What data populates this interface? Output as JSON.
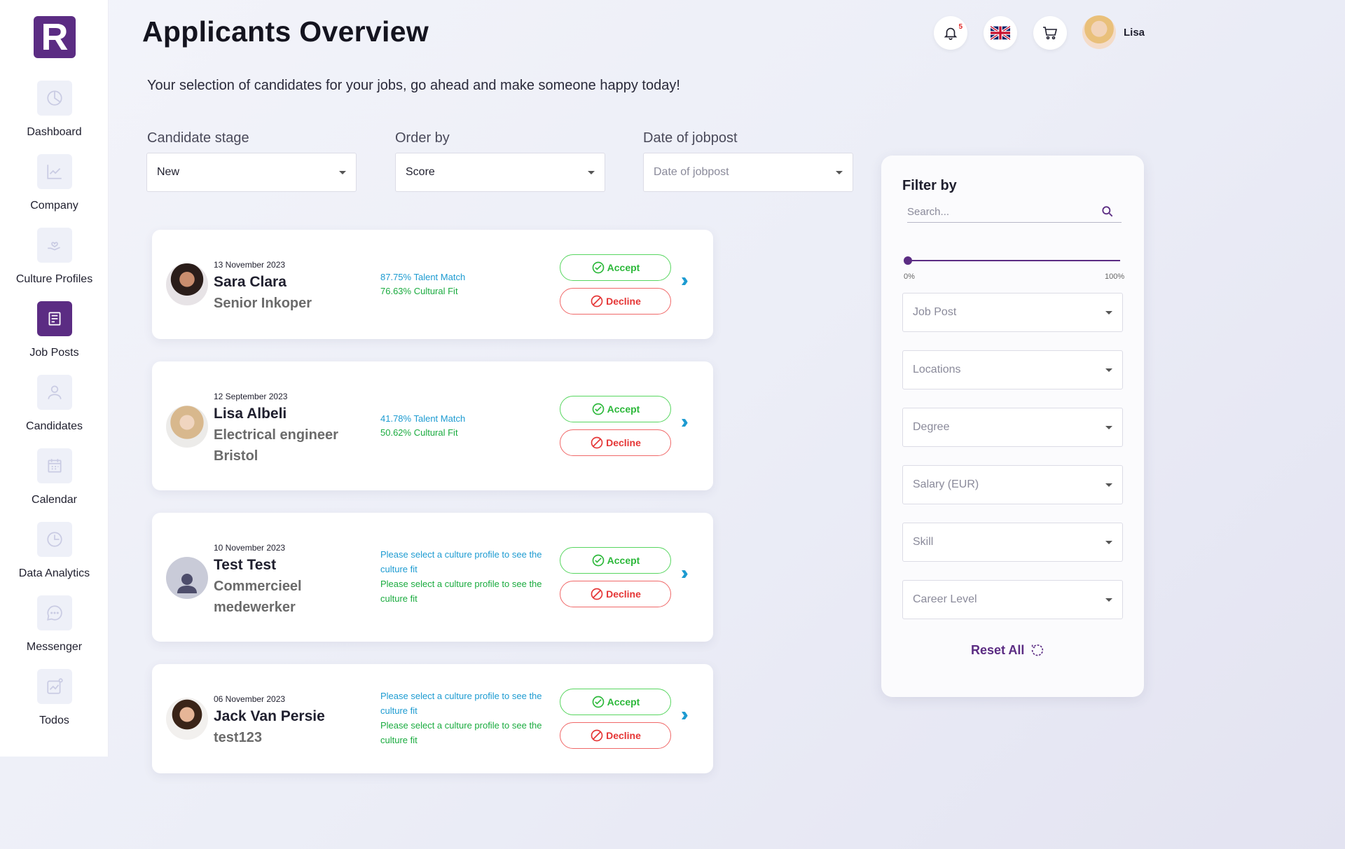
{
  "sidebar": {
    "logo": "R",
    "items": [
      {
        "label": "Dashboard",
        "icon": "pie-chart-icon"
      },
      {
        "label": "Company",
        "icon": "trend-chart-icon"
      },
      {
        "label": "Culture Profiles",
        "icon": "hand-heart-icon"
      },
      {
        "label": "Job Posts",
        "icon": "document-icon",
        "active": true
      },
      {
        "label": "Candidates",
        "icon": "user-icon"
      },
      {
        "label": "Calendar",
        "icon": "calendar-icon"
      },
      {
        "label": "Data Analytics",
        "icon": "clock-chart-icon"
      },
      {
        "label": "Messenger",
        "icon": "chat-icon"
      },
      {
        "label": "Todos",
        "icon": "todo-chart-icon"
      }
    ]
  },
  "header": {
    "title": "Applicants Overview",
    "subtitle": "Your selection of candidates for your jobs, go ahead and make someone happy today!",
    "notification_count": "5",
    "user_name": "Lisa"
  },
  "filters": {
    "stage": {
      "label": "Candidate stage",
      "value": "New"
    },
    "order": {
      "label": "Order by",
      "value": "Score"
    },
    "date": {
      "label": "Date of jobpost",
      "placeholder": "Date of jobpost"
    }
  },
  "candidates": [
    {
      "date": "13 November 2023",
      "name": "Sara Clara",
      "role_lines": [
        "Senior Inkoper"
      ],
      "talent": "87.75% Talent Match",
      "culture": "76.63% Cultural Fit"
    },
    {
      "date": "12 September 2023",
      "name": "Lisa Albeli",
      "role_lines": [
        "Electrical engineer",
        "Bristol"
      ],
      "talent": "41.78% Talent Match",
      "culture": "50.62% Cultural Fit"
    },
    {
      "date": "10 November 2023",
      "name": "Test Test",
      "role_lines": [
        "Commercieel",
        "medewerker"
      ],
      "talent": "Please select a culture profile to see the culture fit",
      "culture": "Please select a culture profile to see the culture fit"
    },
    {
      "date": "06 November 2023",
      "name": "Jack Van Persie",
      "role_lines": [
        "test123"
      ],
      "talent": "Please select a culture profile to see the culture fit",
      "culture": "Please select a culture profile to see the culture fit"
    }
  ],
  "actions": {
    "accept": "Accept",
    "decline": "Decline"
  },
  "filter_panel": {
    "title": "Filter by",
    "search_placeholder": "Search...",
    "slider": {
      "min_label": "0%",
      "max_label": "100%",
      "value": 0
    },
    "selects": [
      "Job Post",
      "Locations",
      "Degree",
      "Salary (EUR)",
      "Skill",
      "Career Level"
    ],
    "reset": "Reset All"
  },
  "colors": {
    "brand": "#5b2c83",
    "accept": "#2cb83a",
    "decline": "#e53535",
    "link": "#1d9bd1"
  }
}
